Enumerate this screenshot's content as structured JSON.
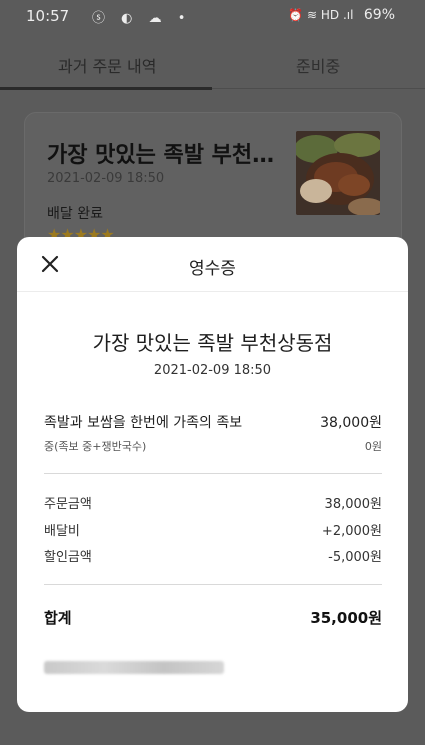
{
  "status_bar": {
    "time": "10:57",
    "left_icons": "ⓢ ◐ ☁ •",
    "right_icons": "⏰ ≋ HD .ıl",
    "battery": "69%"
  },
  "tabs": {
    "past_orders": "과거 주문 내역",
    "preparing": "준비중"
  },
  "order_card": {
    "store_name": "가장 맛있는 족발 부천…",
    "date": "2021-02-09 18:50",
    "status": "배달 완료",
    "rating_stars": "★★★★★",
    "rating_value": 5
  },
  "receipt": {
    "title": "영수증",
    "store_name": "가장 맛있는 족발 부천상동점",
    "order_date": "2021-02-09 18:50",
    "item_name": "족발과 보쌈을 한번에 가족의 족보",
    "item_price": "38,000원",
    "option_name": "중(족보 중+쟁반국수)",
    "option_price": "0원",
    "fees": [
      {
        "label": "주문금액",
        "value": "38,000원"
      },
      {
        "label": "배달비",
        "value": "+2,000원"
      },
      {
        "label": "할인금액",
        "value": "-5,000원"
      }
    ],
    "total_label": "합계",
    "total_value": "35,000원"
  },
  "colors": {
    "overlay": "#5b5b5b",
    "modal_bg": "#ffffff",
    "star": "#f5b400",
    "text": "#222222"
  },
  "icons": {
    "close": "close-icon"
  }
}
